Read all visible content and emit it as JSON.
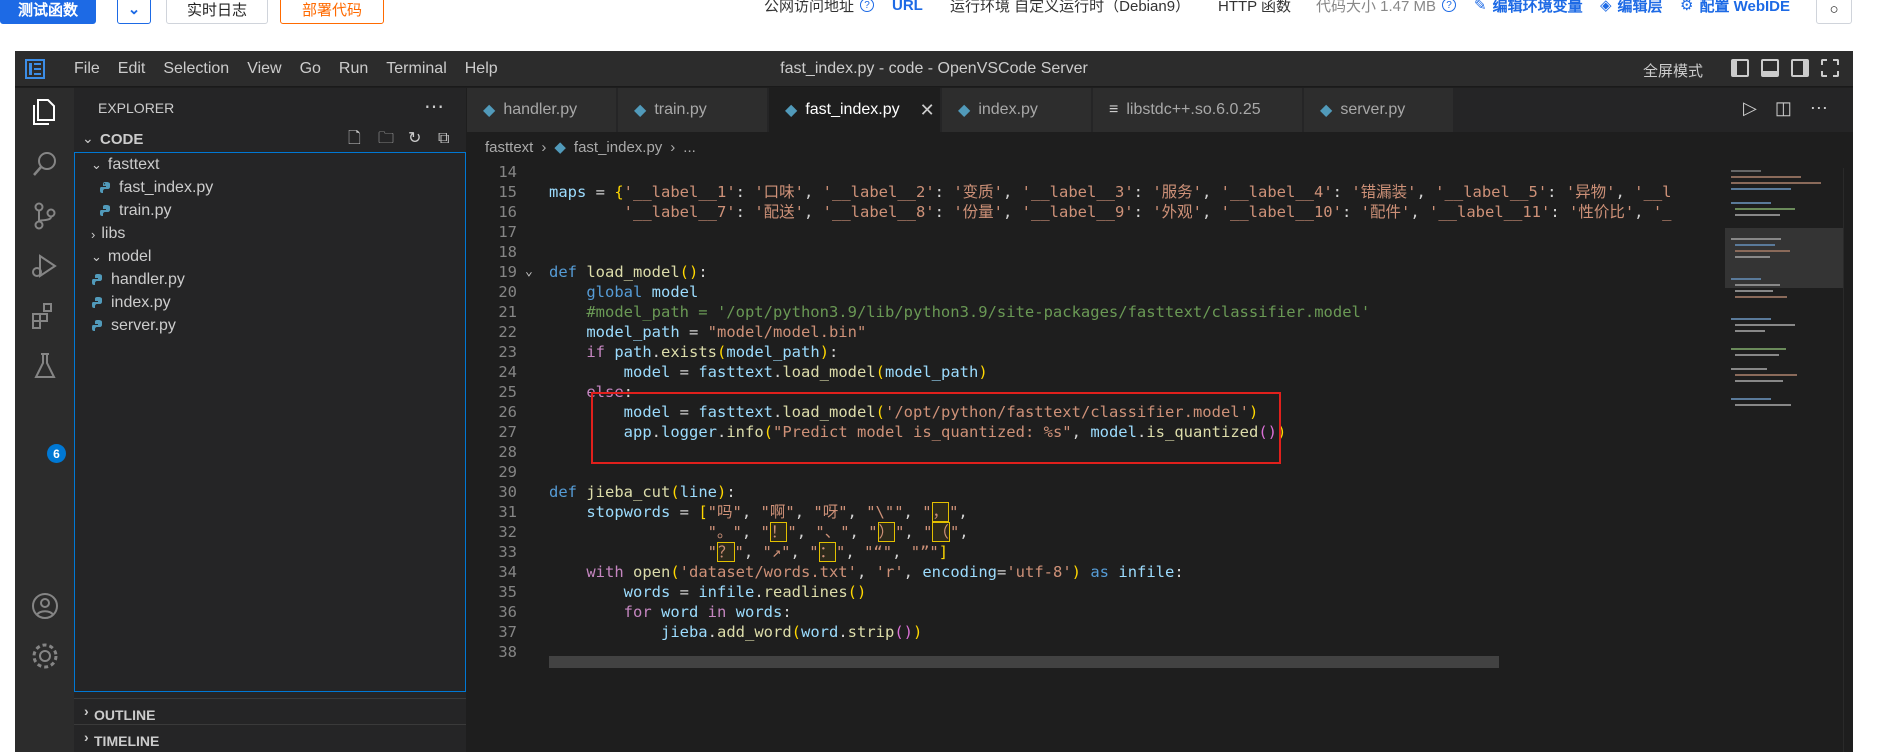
{
  "topbar": {
    "test_fn_label": "测试函数",
    "realtime_log_label": "实时日志",
    "deploy_code_label": "部署代码",
    "public_url_label": "公网访问地址",
    "url_link": "URL",
    "runtime_label": "运行环境 自定义运行时（Debian9）",
    "http_fn_label": "HTTP 函数",
    "code_size_label": "代码大小 1.47 MB",
    "edit_env_label": "编辑环境变量",
    "edit_layer_label": "编辑层",
    "config_webide_label": "配置 WebIDE"
  },
  "window": {
    "title": "fast_index.py - code - OpenVSCode Server",
    "fullscreen_label": "全屏模式",
    "menu": [
      "File",
      "Edit",
      "Selection",
      "View",
      "Go",
      "Run",
      "Terminal",
      "Help"
    ]
  },
  "activity": {
    "extensions_badge": "6"
  },
  "sidebar": {
    "title": "EXPLORER",
    "root_label": "CODE",
    "tree": [
      {
        "label": "fasttext",
        "type": "folder-open"
      },
      {
        "label": "fast_index.py",
        "type": "py"
      },
      {
        "label": "train.py",
        "type": "py"
      },
      {
        "label": "libs",
        "type": "folder-closed"
      },
      {
        "label": "model",
        "type": "folder-open"
      },
      {
        "label": "handler.py",
        "type": "py"
      },
      {
        "label": "index.py",
        "type": "py"
      },
      {
        "label": "server.py",
        "type": "py"
      }
    ],
    "outline_label": "OUTLINE",
    "timeline_label": "TIMELINE"
  },
  "tabs": [
    {
      "label": "handler.py",
      "icon": "python-icon"
    },
    {
      "label": "train.py",
      "icon": "python-icon"
    },
    {
      "label": "fast_index.py",
      "icon": "python-icon",
      "active": true
    },
    {
      "label": "index.py",
      "icon": "python-icon"
    },
    {
      "label": "libstdc++.so.6.0.25",
      "icon": "lines-icon"
    },
    {
      "label": "server.py",
      "icon": "python-icon"
    }
  ],
  "breadcrumb": [
    "fasttext",
    "fast_index.py",
    "..."
  ],
  "code": {
    "line_numbers": [
      "14",
      "15",
      "16",
      "17",
      "18",
      "19",
      "20",
      "21",
      "22",
      "23",
      "24",
      "25",
      "26",
      "27",
      "28",
      "29",
      "30",
      "31",
      "32",
      "33",
      "34",
      "35",
      "36",
      "37",
      "38"
    ]
  },
  "colors": {
    "accent": "#0078d4",
    "highlight_box": "#e0201c",
    "primary_button": "#1d6ae5",
    "deploy_orange": "#ff6a00"
  }
}
